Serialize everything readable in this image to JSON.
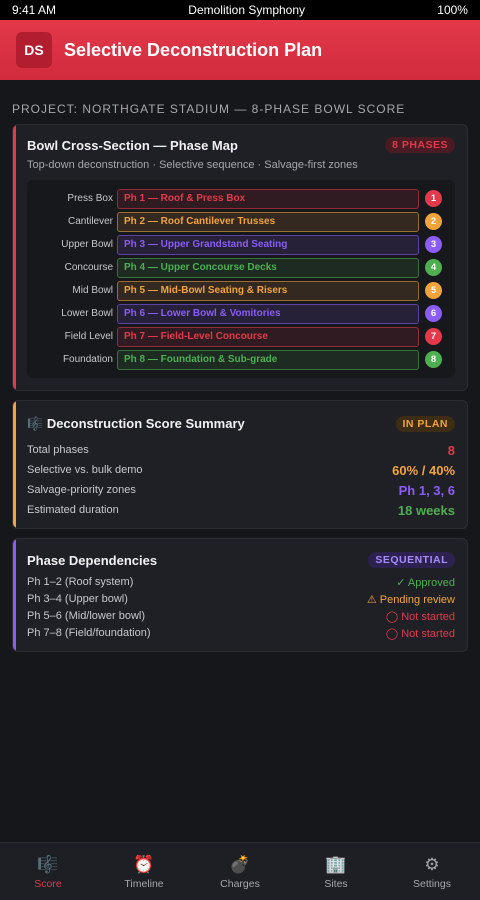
{
  "status_bar": {
    "time": "9:41 AM",
    "app": "Demolition Symphony",
    "battery": "100%"
  },
  "header": {
    "logo": "DS",
    "title": "Selective Deconstruction Plan",
    "color": "#e3394a"
  },
  "project_label": "PROJECT: NORTHGATE STADIUM — 8-PHASE BOWL SCORE",
  "phase_map": {
    "title": "Bowl Cross-Section — Phase Map",
    "badge": "8 PHASES",
    "subtitle": "Top-down deconstruction · Selective sequence · Salvage-first zones",
    "rows": [
      {
        "zone": "Press Box",
        "label": "Ph 1 — Roof & Press Box",
        "num": "1",
        "color": "#e3394a"
      },
      {
        "zone": "Cantilever",
        "label": "Ph 2 — Roof Cantilever Trusses",
        "num": "2",
        "color": "#f2a43a"
      },
      {
        "zone": "Upper Bowl",
        "label": "Ph 3 — Upper Grandstand Seating",
        "num": "3",
        "color": "#8b5cf6"
      },
      {
        "zone": "Concourse",
        "label": "Ph 4 — Upper Concourse Decks",
        "num": "4",
        "color": "#4caf50"
      },
      {
        "zone": "Mid Bowl",
        "label": "Ph 5 — Mid-Bowl Seating & Risers",
        "num": "5",
        "color": "#f2a43a"
      },
      {
        "zone": "Lower Bowl",
        "label": "Ph 6 — Lower Bowl & Vomitories",
        "num": "6",
        "color": "#8b5cf6"
      },
      {
        "zone": "Field Level",
        "label": "Ph 7 — Field-Level Concourse",
        "num": "7",
        "color": "#e3394a"
      },
      {
        "zone": "Foundation",
        "label": "Ph 8 — Foundation & Sub-grade",
        "num": "8",
        "color": "#4caf50"
      }
    ]
  },
  "score_summary": {
    "icon": "🎼",
    "title": "Deconstruction Score Summary",
    "badge": "IN PLAN",
    "rows": [
      {
        "key": "Total phases",
        "value": "8",
        "color": "#e3394a"
      },
      {
        "key": "Selective vs. bulk demo",
        "value": "60% / 40%",
        "color": "#f2a43a"
      },
      {
        "key": "Salvage-priority zones",
        "value": "Ph 1, 3, 6",
        "color": "#8b5cf6"
      },
      {
        "key": "Estimated duration",
        "value": "18 weeks",
        "color": "#4caf50"
      }
    ]
  },
  "dependencies": {
    "title": "Phase Dependencies",
    "badge": "SEQUENTIAL",
    "rows": [
      {
        "key": "Ph 1–2 (Roof system)",
        "status": "✓ Approved",
        "color": "#4caf50"
      },
      {
        "key": "Ph 3–4 (Upper bowl)",
        "status": "⚠ Pending review",
        "color": "#f2a43a"
      },
      {
        "key": "Ph 5–6 (Mid/lower bowl)",
        "status": "◯ Not started",
        "color": "#e3394a"
      },
      {
        "key": "Ph 7–8 (Field/foundation)",
        "status": "◯ Not started",
        "color": "#e3394a"
      }
    ]
  },
  "bottom_nav": [
    {
      "icon": "🎼",
      "label": "Score",
      "active": true
    },
    {
      "icon": "⏰",
      "label": "Timeline",
      "active": false
    },
    {
      "icon": "💣",
      "label": "Charges",
      "active": false
    },
    {
      "icon": "🏢",
      "label": "Sites",
      "active": false
    },
    {
      "icon": "⚙",
      "label": "Settings",
      "active": false
    }
  ]
}
